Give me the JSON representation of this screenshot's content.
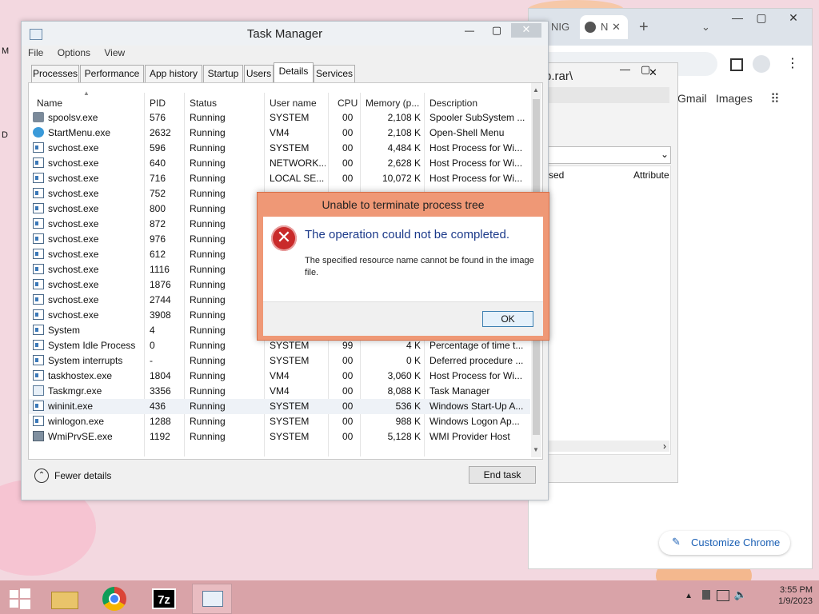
{
  "desktop": {
    "left_icon_labels": [
      "M",
      "D"
    ]
  },
  "chrome": {
    "tabs": [
      "NIG",
      "N"
    ],
    "new_tab": "+",
    "links": [
      "Gmail",
      "Images"
    ],
    "customize_label": "Customize Chrome",
    "window_controls": [
      "—",
      "▢",
      "✕"
    ]
  },
  "inner_window": {
    "path_text": "p.rar\\",
    "columns": [
      "sed",
      "Attribute"
    ]
  },
  "task_manager": {
    "title": "Task Manager",
    "window_controls": [
      "—",
      "▢",
      "✕"
    ],
    "menu": [
      "File",
      "Options",
      "View"
    ],
    "tabs": [
      "Processes",
      "Performance",
      "App history",
      "Startup",
      "Users",
      "Details",
      "Services"
    ],
    "selected_tab": "Details",
    "columns": [
      "Name",
      "PID",
      "Status",
      "User name",
      "CPU",
      "Memory (p...",
      "Description"
    ],
    "rows": [
      {
        "icon": "printer-icon",
        "name": "spoolsv.exe",
        "pid": "576",
        "status": "Running",
        "user": "SYSTEM",
        "cpu": "00",
        "mem": "2,108 K",
        "desc": "Spooler SubSystem ..."
      },
      {
        "icon": "globe-icon",
        "name": "StartMenu.exe",
        "pid": "2632",
        "status": "Running",
        "user": "VM4",
        "cpu": "00",
        "mem": "2,108 K",
        "desc": "Open-Shell Menu"
      },
      {
        "icon": "service-icon",
        "name": "svchost.exe",
        "pid": "596",
        "status": "Running",
        "user": "SYSTEM",
        "cpu": "00",
        "mem": "4,484 K",
        "desc": "Host Process for Wi..."
      },
      {
        "icon": "service-icon",
        "name": "svchost.exe",
        "pid": "640",
        "status": "Running",
        "user": "NETWORK...",
        "cpu": "00",
        "mem": "2,628 K",
        "desc": "Host Process for Wi..."
      },
      {
        "icon": "service-icon",
        "name": "svchost.exe",
        "pid": "716",
        "status": "Running",
        "user": "LOCAL SE...",
        "cpu": "00",
        "mem": "10,072 K",
        "desc": "Host Process for Wi..."
      },
      {
        "icon": "service-icon",
        "name": "svchost.exe",
        "pid": "752",
        "status": "Running",
        "user": "",
        "cpu": "",
        "mem": "",
        "desc": ""
      },
      {
        "icon": "service-icon",
        "name": "svchost.exe",
        "pid": "800",
        "status": "Running",
        "user": "",
        "cpu": "",
        "mem": "",
        "desc": ""
      },
      {
        "icon": "service-icon",
        "name": "svchost.exe",
        "pid": "872",
        "status": "Running",
        "user": "",
        "cpu": "",
        "mem": "",
        "desc": ""
      },
      {
        "icon": "service-icon",
        "name": "svchost.exe",
        "pid": "976",
        "status": "Running",
        "user": "",
        "cpu": "",
        "mem": "",
        "desc": ""
      },
      {
        "icon": "service-icon",
        "name": "svchost.exe",
        "pid": "612",
        "status": "Running",
        "user": "",
        "cpu": "",
        "mem": "",
        "desc": ""
      },
      {
        "icon": "service-icon",
        "name": "svchost.exe",
        "pid": "1116",
        "status": "Running",
        "user": "",
        "cpu": "",
        "mem": "",
        "desc": ""
      },
      {
        "icon": "service-icon",
        "name": "svchost.exe",
        "pid": "1876",
        "status": "Running",
        "user": "",
        "cpu": "",
        "mem": "",
        "desc": ""
      },
      {
        "icon": "service-icon",
        "name": "svchost.exe",
        "pid": "2744",
        "status": "Running",
        "user": "",
        "cpu": "",
        "mem": "",
        "desc": ""
      },
      {
        "icon": "service-icon",
        "name": "svchost.exe",
        "pid": "3908",
        "status": "Running",
        "user": "",
        "cpu": "",
        "mem": "",
        "desc": ""
      },
      {
        "icon": "service-icon",
        "name": "System",
        "pid": "4",
        "status": "Running",
        "user": "",
        "cpu": "",
        "mem": "",
        "desc": ""
      },
      {
        "icon": "service-icon",
        "name": "System Idle Process",
        "pid": "0",
        "status": "Running",
        "user": "SYSTEM",
        "cpu": "99",
        "mem": "4 K",
        "desc": "Percentage of time t..."
      },
      {
        "icon": "service-icon",
        "name": "System interrupts",
        "pid": "-",
        "status": "Running",
        "user": "SYSTEM",
        "cpu": "00",
        "mem": "0 K",
        "desc": "Deferred procedure ..."
      },
      {
        "icon": "service-icon",
        "name": "taskhostex.exe",
        "pid": "1804",
        "status": "Running",
        "user": "VM4",
        "cpu": "00",
        "mem": "3,060 K",
        "desc": "Host Process for Wi..."
      },
      {
        "icon": "chart-icon",
        "name": "Taskmgr.exe",
        "pid": "3356",
        "status": "Running",
        "user": "VM4",
        "cpu": "00",
        "mem": "8,088 K",
        "desc": "Task Manager"
      },
      {
        "icon": "service-icon",
        "name": "wininit.exe",
        "pid": "436",
        "status": "Running",
        "user": "SYSTEM",
        "cpu": "00",
        "mem": "536 K",
        "desc": "Windows Start-Up A...",
        "selected": true
      },
      {
        "icon": "service-icon",
        "name": "winlogon.exe",
        "pid": "1288",
        "status": "Running",
        "user": "SYSTEM",
        "cpu": "00",
        "mem": "988 K",
        "desc": "Windows Logon Ap..."
      },
      {
        "icon": "wmi-icon",
        "name": "WmiPrvSE.exe",
        "pid": "1192",
        "status": "Running",
        "user": "SYSTEM",
        "cpu": "00",
        "mem": "5,128 K",
        "desc": "WMI Provider Host"
      }
    ],
    "fewer_details": "Fewer details",
    "end_task": "End task"
  },
  "dialog": {
    "title": "Unable to terminate process tree",
    "main_instruction": "The operation could not be completed.",
    "message": "The specified resource name cannot be found in the image file.",
    "ok_label": "OK",
    "icon": "error-icon"
  },
  "taskbar": {
    "apps": [
      "file-explorer-icon",
      "chrome-icon",
      "7zip-icon",
      "task-manager-icon"
    ],
    "sevenzip_label": "7z",
    "time": "3:55 PM",
    "date": "1/9/2023"
  },
  "colors": {
    "dialog_frame": "#ef9876",
    "dialog_heading": "#1c3a8a",
    "error_red": "#c92a2a",
    "taskbar": "#d9a3a8",
    "desktop": "#f3d8e0"
  }
}
